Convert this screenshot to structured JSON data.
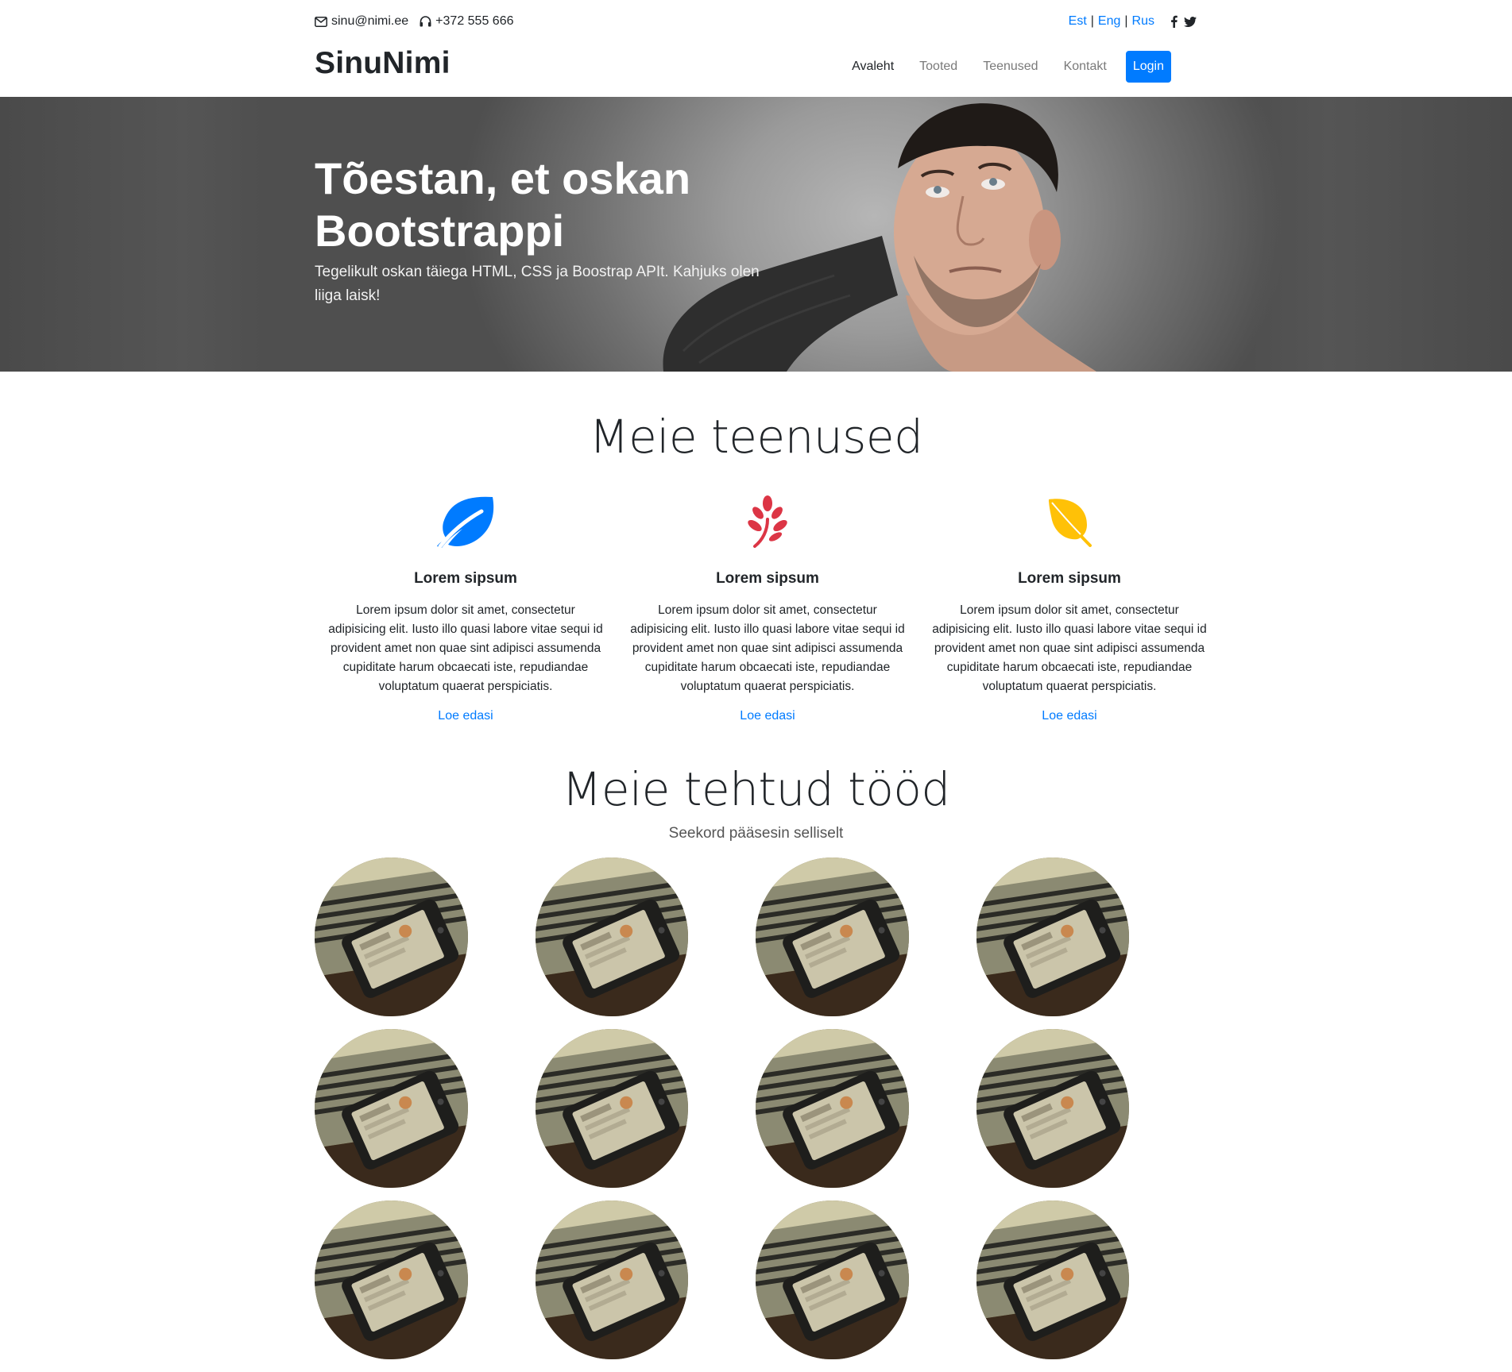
{
  "topbar": {
    "email": "sinu@nimi.ee",
    "phone": "+372 555 666",
    "languages": [
      "Est",
      "Eng",
      "Rus"
    ],
    "social": [
      "facebook-icon",
      "twitter-icon"
    ]
  },
  "navbar": {
    "brand": "SinuNimi",
    "links": [
      "Avaleht",
      "Tooted",
      "Teenused",
      "Kontakt"
    ],
    "login": "Login"
  },
  "hero": {
    "title": "Tõestan, et oskan Bootstrappi",
    "text": "Tegelikult oskan täiega HTML, CSS ja Boostrap APIt. Kahjuks olen liiga laisk!"
  },
  "services": {
    "title": "Meie teenused",
    "items": [
      {
        "icon": "leaf-icon",
        "color": "#007bff",
        "heading": "Lorem sipsum",
        "text": "Lorem ipsum dolor sit amet, consectetur adipisicing elit. Iusto illo quasi labore vitae sequi id provident amet non quae sint adipisci assumenda cupiditate harum obcaecati iste, repudiandae voluptatum quaerat perspiciatis.",
        "link": "Loe edasi"
      },
      {
        "icon": "spa-icon",
        "color": "#dc3545",
        "heading": "Lorem sipsum",
        "text": "Lorem ipsum dolor sit amet, consectetur adipisicing elit. Iusto illo quasi labore vitae sequi id provident amet non quae sint adipisci assumenda cupiditate harum obcaecati iste, repudiandae voluptatum quaerat perspiciatis.",
        "link": "Loe edasi"
      },
      {
        "icon": "autumn-leaf-icon",
        "color": "#ffc107",
        "heading": "Lorem sipsum",
        "text": "Lorem ipsum dolor sit amet, consectetur adipisicing elit. Iusto illo quasi labore vitae sequi id provident amet non quae sint adipisci assumenda cupiditate harum obcaecati iste, repudiandae voluptatum quaerat perspiciatis.",
        "link": "Loe edasi"
      }
    ]
  },
  "works": {
    "title": "Meie tehtud tööd",
    "subtitle": "Seekord pääsesin selliselt"
  }
}
